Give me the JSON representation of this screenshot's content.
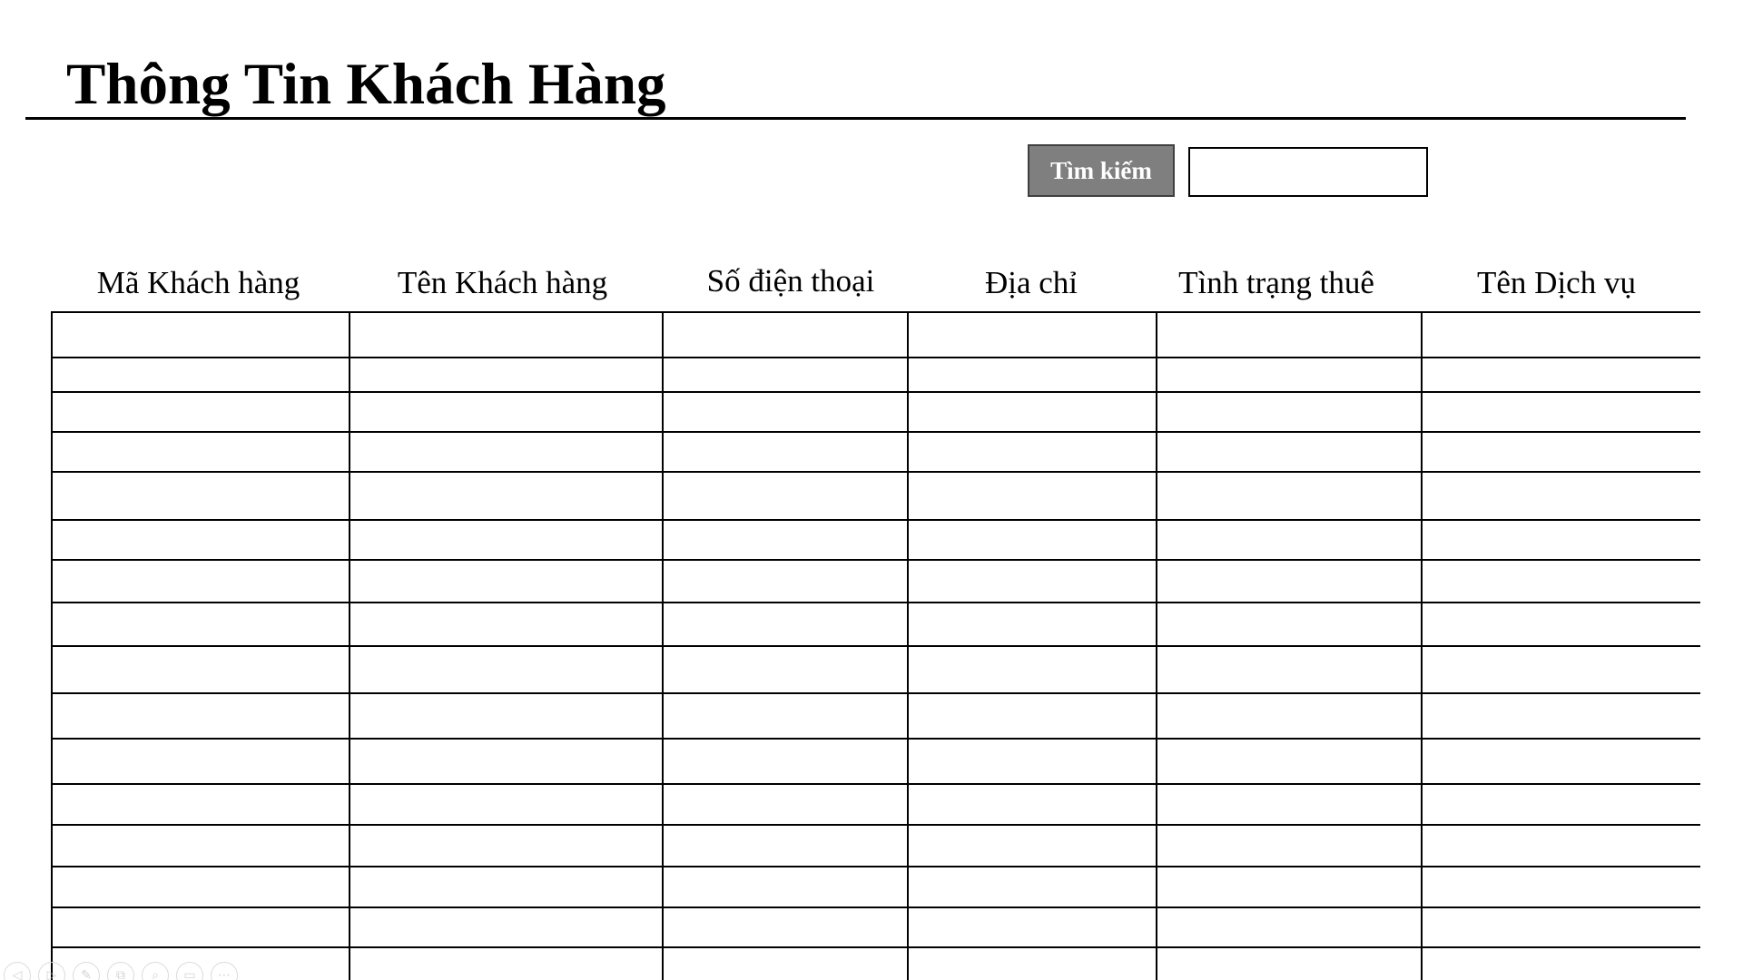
{
  "page": {
    "title": "Thông Tin Khách Hàng"
  },
  "search": {
    "button_label": "Tìm kiếm",
    "input_value": "",
    "placeholder": ""
  },
  "table": {
    "columns": [
      "Mã Khách hàng",
      "Tên Khách hàng",
      "Số điện thoại",
      "Địa chỉ",
      "Tình trạng thuê",
      "Tên Dịch vụ"
    ],
    "row_count": 16,
    "rows": []
  },
  "toolbar": {
    "icons": [
      {
        "name": "previous-icon",
        "glyph": "◁"
      },
      {
        "name": "next-icon",
        "glyph": "▷"
      },
      {
        "name": "pen-icon",
        "glyph": "✎"
      },
      {
        "name": "slides-icon",
        "glyph": "⧉"
      },
      {
        "name": "zoom-icon",
        "glyph": "⌕"
      },
      {
        "name": "subtitles-icon",
        "glyph": "▭"
      },
      {
        "name": "more-icon",
        "glyph": "⋯"
      }
    ]
  },
  "colors": {
    "search_button_bg": "#7f7f7f",
    "search_button_text": "#ffffff",
    "border": "#000000"
  }
}
